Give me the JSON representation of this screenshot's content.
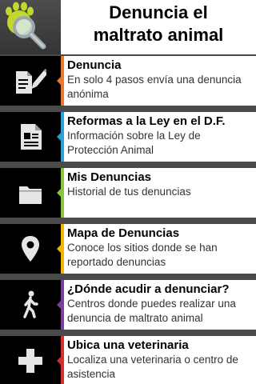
{
  "header": {
    "title_line1": "Denuncia el",
    "title_line2": "maltrato animal",
    "logo_icon": "paw-magnifier-icon"
  },
  "menu": {
    "items": [
      {
        "title": "Denuncia",
        "description": "En solo 4 pasos envía una denuncia anónima",
        "icon": "edit-document-icon",
        "accent": "#e87a2d"
      },
      {
        "title": "Reformas a la Ley en el D.F.",
        "description": "Información sobre la Ley de Protección Animal",
        "icon": "document-icon",
        "accent": "#2aa0d8"
      },
      {
        "title": "Mis Denuncias",
        "description": "Historial de tus denuncias",
        "icon": "folder-icon",
        "accent": "#8bc53f"
      },
      {
        "title": "Mapa de Denuncias",
        "description": "Conoce los sitios donde se han reportado denuncias",
        "icon": "map-pin-icon",
        "accent": "#f4b400"
      },
      {
        "title": "¿Dónde acudir a denunciar?",
        "description": "Centros donde puedes realizar una denuncia de maltrato animal",
        "icon": "walking-person-icon",
        "accent": "#7b3fa0"
      },
      {
        "title": "Ubica una veterinaria",
        "description": "Localiza una veterinaria o centro de asistencia",
        "icon": "plus-icon",
        "accent": "#d62f2f"
      }
    ]
  }
}
